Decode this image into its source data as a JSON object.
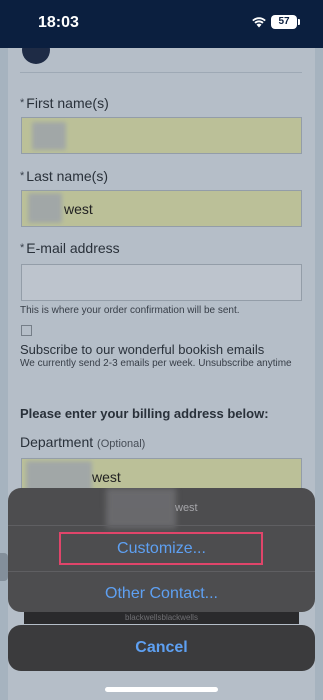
{
  "status_bar": {
    "time": "18:03",
    "battery": "57"
  },
  "form": {
    "first_name_label": "First name(s)",
    "first_name_value": "",
    "last_name_label": "Last name(s)",
    "last_name_value": "west",
    "email_label": "E-mail address",
    "email_value": "",
    "email_hint": "This is where your order confirmation will be sent.",
    "subscribe_title": "Subscribe to our wonderful bookish emails",
    "subscribe_text": "We currently send 2-3 emails per week. Unsubscribe anytime",
    "billing_heading": "Please enter your billing address below:",
    "department_label": "Department",
    "department_optional": "(Optional)",
    "department_value": "west"
  },
  "action_sheet": {
    "header_text": "west",
    "customize_label": "Customize...",
    "other_contact_label": "Other Contact...",
    "peek_text": "blackwellsblackwells",
    "cancel_label": "Cancel"
  },
  "colors": {
    "accent": "#5ea0f2",
    "highlight": "#e0456a",
    "field_autofill": "#c9cfa2"
  }
}
